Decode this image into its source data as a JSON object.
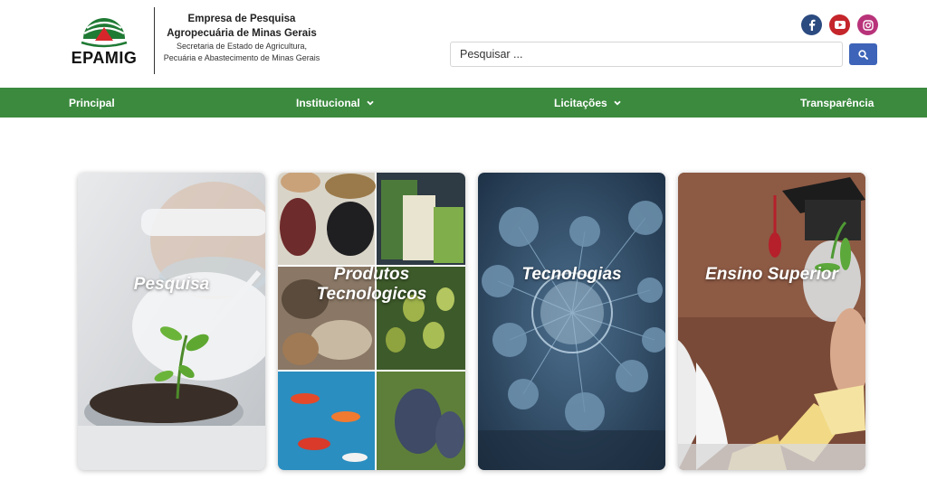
{
  "header": {
    "logo_text": "EPAMIG",
    "org_line1": "Empresa de Pesquisa",
    "org_line2": "Agropecuária de Minas Gerais",
    "org_line3": "Secretaria de Estado de Agricultura,",
    "org_line4": "Pecuária e Abastecimento de Minas Gerais"
  },
  "social": [
    {
      "name": "facebook-icon",
      "color": "#2b4a80"
    },
    {
      "name": "youtube-icon",
      "color": "#c4262b"
    },
    {
      "name": "instagram-icon",
      "color": "#b8337a"
    }
  ],
  "search": {
    "placeholder": "Pesquisar ...",
    "button_icon": "search-icon"
  },
  "nav": {
    "color": "#3b8a3e",
    "items": [
      {
        "label": "Principal",
        "has_dropdown": false
      },
      {
        "label": "Institucional",
        "has_dropdown": true
      },
      {
        "label": "Licitações",
        "has_dropdown": true
      },
      {
        "label": "Transparência",
        "has_dropdown": false
      }
    ]
  },
  "cards": [
    {
      "title": "Pesquisa"
    },
    {
      "title_line1": "Produtos",
      "title_line2": "Tecnologicos"
    },
    {
      "title": "Tecnologias"
    },
    {
      "title": "Ensino Superior"
    }
  ]
}
